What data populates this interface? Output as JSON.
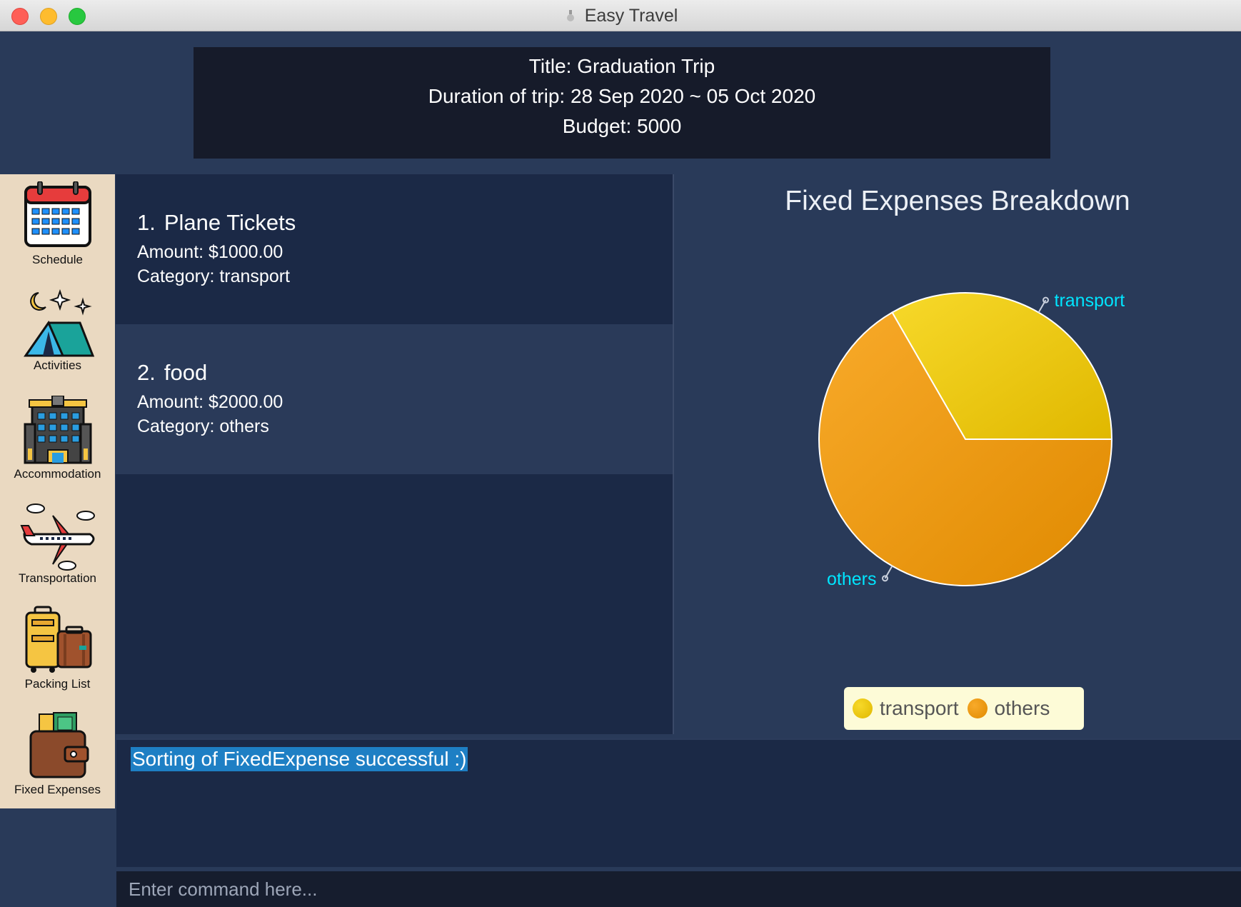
{
  "window": {
    "title": "Easy Travel"
  },
  "trip": {
    "title_line": "Title: Graduation Trip",
    "duration_line": "Duration of trip: 28 Sep 2020 ~ 05 Oct 2020",
    "budget_line": "Budget: 5000"
  },
  "sidebar": {
    "items": [
      {
        "label": "Schedule",
        "icon": "calendar-icon"
      },
      {
        "label": "Activities",
        "icon": "tent-icon"
      },
      {
        "label": "Accommodation",
        "icon": "hotel-icon"
      },
      {
        "label": "Transportation",
        "icon": "airplane-icon"
      },
      {
        "label": "Packing List",
        "icon": "luggage-icon"
      },
      {
        "label": "Fixed Expenses",
        "icon": "wallet-icon"
      }
    ]
  },
  "expenses": [
    {
      "index": "1.",
      "name": "Plane Tickets",
      "amount": "Amount: $1000.00",
      "category": "Category: transport"
    },
    {
      "index": "2.",
      "name": "food",
      "amount": "Amount: $2000.00",
      "category": "Category: others"
    }
  ],
  "chart_data": {
    "type": "pie",
    "title": "Fixed Expenses Breakdown",
    "categories": [
      "transport",
      "others"
    ],
    "values": [
      1000,
      2000
    ],
    "colors": [
      "#ebc90f",
      "#f0a01e"
    ],
    "legend": "bottom"
  },
  "result": {
    "message": "Sorting of FixedExpense successful :)"
  },
  "command": {
    "placeholder": "Enter command here..."
  },
  "colors": {
    "background": "#293a59",
    "list_bg": "#1b2946",
    "label_cyan": "#00e5ff",
    "highlight": "#1e7fc4"
  }
}
